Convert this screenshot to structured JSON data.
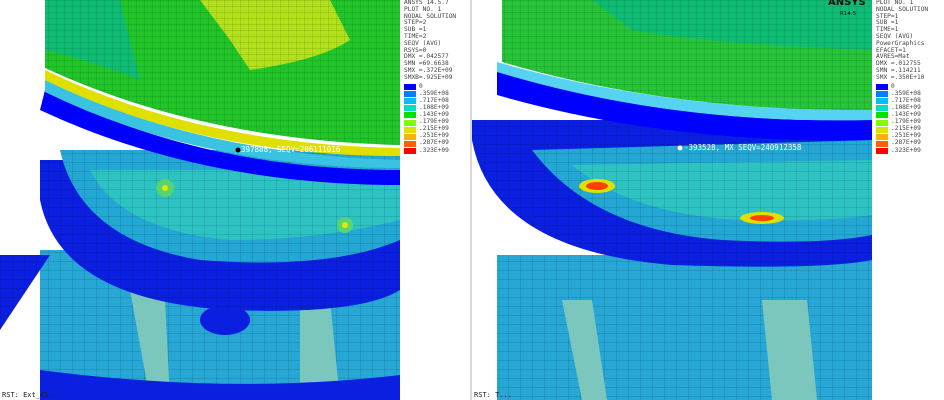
{
  "left": {
    "header": [
      "ANSYS 14.5.7",
      "PLOT NO.   1",
      "NODAL SOLUTION",
      "STEP=2",
      "SUB =1",
      "TIME=2",
      "SEQV     (AVG)",
      "RSYS=0",
      "DMX =.042577",
      "SMN =69.6638",
      "SMX =.372E+09",
      "SMXB=.925E+09"
    ],
    "scale": [
      "0",
      ".359E+08",
      ".717E+08",
      ".108E+09",
      ".143E+09",
      ".179E+09",
      ".215E+09",
      ".251E+09",
      ".287E+09",
      ".323E+09"
    ],
    "annotation": "397888, SEQV=206111016",
    "footer": "RST: Ext_45..."
  },
  "right": {
    "brand": "ANSYS",
    "version": "R14.5",
    "header": [
      "PLOT NO.   1",
      "NODAL SOLUTION",
      "STEP=1",
      "SUB =1",
      "TIME=1",
      "SEQV     (AVG)",
      "PowerGraphics",
      "EFACET=1",
      "AVRES=Mat",
      "DMX =.012755",
      "SMN =.114211",
      "SMX =.350E+10"
    ],
    "scale": [
      "0",
      ".359E+08",
      ".717E+08",
      ".108E+09",
      ".143E+09",
      ".179E+09",
      ".215E+09",
      ".251E+09",
      ".287E+09",
      ".323E+09"
    ],
    "annotation": "-393528, MX SEQV=240912358",
    "footer": "RST: T..."
  },
  "colors": [
    "#0000ff",
    "#0080ff",
    "#00bfff",
    "#00e0c0",
    "#00e000",
    "#80ff00",
    "#e0e000",
    "#ffb000",
    "#ff6000",
    "#ff0000"
  ]
}
